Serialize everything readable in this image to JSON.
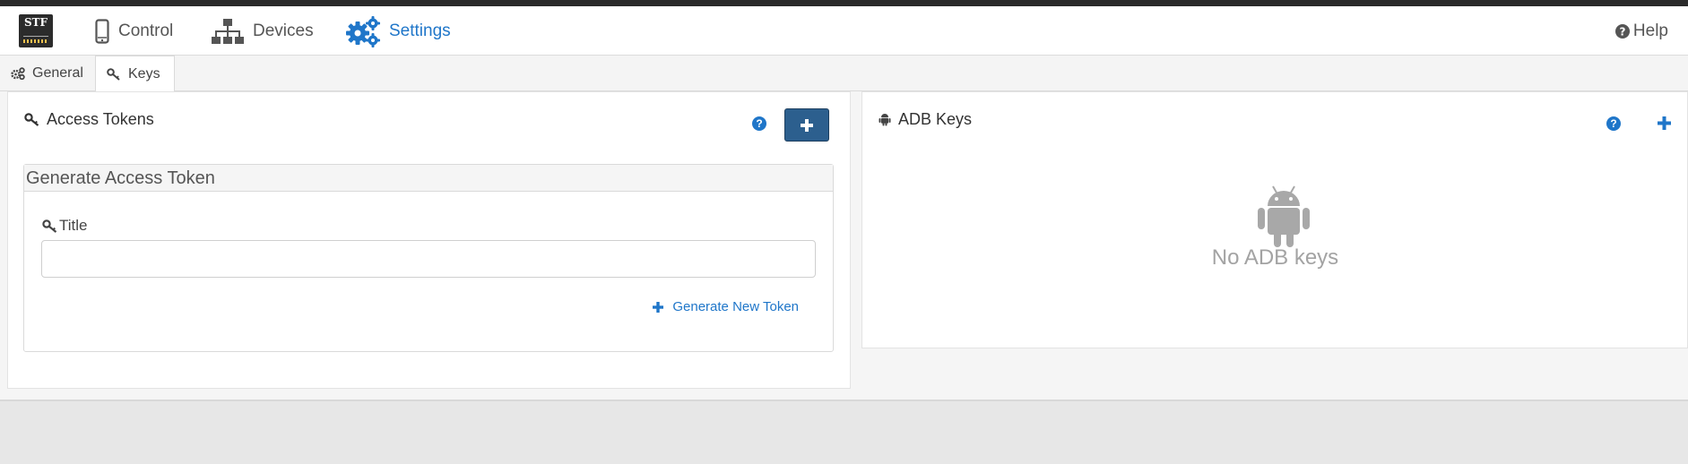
{
  "logo": {
    "text": "STF"
  },
  "nav": {
    "control": "Control",
    "devices": "Devices",
    "settings": "Settings",
    "help": "Help"
  },
  "tabs": [
    {
      "label": "General",
      "icon": "gears-icon",
      "active": false
    },
    {
      "label": "Keys",
      "icon": "key-icon",
      "active": true
    }
  ],
  "access_tokens": {
    "title": "Access Tokens",
    "generate_header": "Generate Access Token",
    "field_label": "Title",
    "field_value": "",
    "generate_link": "Generate New Token"
  },
  "adb_keys": {
    "title": "ADB Keys",
    "empty_text": "No ADB keys"
  },
  "colors": {
    "accent": "#1f76c9",
    "add_button": "#2c5f8e",
    "topbar": "#2a2a2a"
  }
}
